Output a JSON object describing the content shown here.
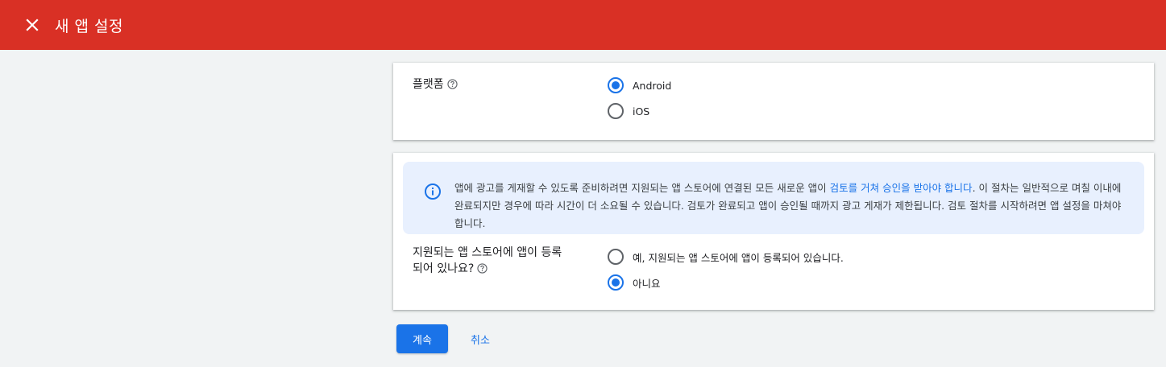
{
  "header": {
    "title": "새 앱 설정",
    "close_icon": "close-icon",
    "background_color": "#d93025"
  },
  "platform": {
    "label": "플랫폼",
    "help_icon": "help-circle-icon",
    "options": [
      {
        "label": "Android",
        "checked": true
      },
      {
        "label": "iOS",
        "checked": false
      }
    ]
  },
  "info": {
    "icon": "info-icon",
    "text_before": "앱에 광고를 게재할 수 있도록 준비하려면 지원되는 앱 스토어에 연결된 모든 새로운 앱이 ",
    "link": "검토를 거쳐 승인을 받아야 합니다",
    "text_after": ". 이 절차는 일반적으로 며칠 이내에 완료되지만 경우에 따라 시간이 더 소요될 수 있습니다. 검토가 완료되고 앱이 승인될 때까지 광고 게재가 제한됩니다. 검토 절차를 시작하려면 앱 설정을 마쳐야 합니다."
  },
  "store": {
    "label_line1": "지원되는 앱 스토어에 앱이 등록",
    "label_line2": "되어 있나요?",
    "help_icon": "help-circle-icon",
    "options": [
      {
        "label": "예, 지원되는 앱 스토어에 앱이 등록되어 있습니다.",
        "checked": false
      },
      {
        "label": "아니요",
        "checked": true
      }
    ]
  },
  "actions": {
    "continue_label": "계속",
    "cancel_label": "취소"
  },
  "colors": {
    "accent": "#1a73e8",
    "info_bg": "#e8f0fe"
  }
}
